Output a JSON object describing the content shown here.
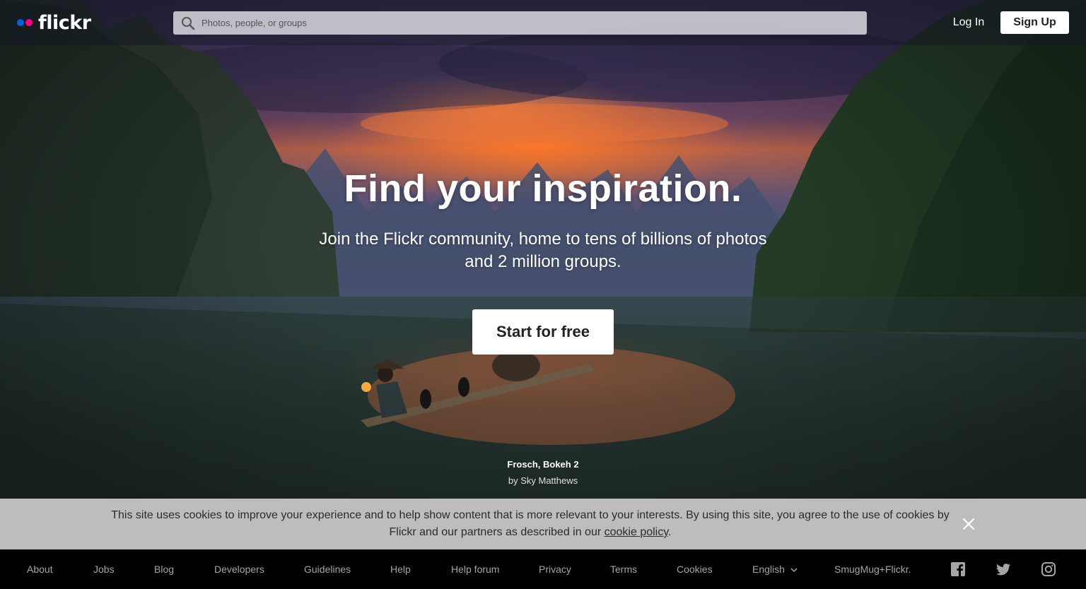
{
  "header": {
    "logo_text": "flickr",
    "search_placeholder": "Photos, people, or groups",
    "login_label": "Log In",
    "signup_label": "Sign Up"
  },
  "hero": {
    "headline": "Find your inspiration.",
    "subline": "Join the Flickr community, home to tens of billions of photos and 2 million groups.",
    "cta_label": "Start for free",
    "photo_credit": {
      "title": "Frosch, Bokeh 2",
      "author_prefix": "by",
      "author": "Sky Matthews"
    }
  },
  "cookie_banner": {
    "text_before_link": "This site uses cookies to improve your experience and to help show content that is more relevant to your interests. By using this site, you agree to the use of cookies by Flickr and our partners as described in our ",
    "link_label": "cookie policy",
    "text_after_link": ".",
    "close_icon": "close-icon"
  },
  "footer": {
    "links": [
      "About",
      "Jobs",
      "Blog",
      "Developers",
      "Guidelines",
      "Help",
      "Help forum",
      "Privacy",
      "Terms",
      "Cookies",
      "English",
      "SmugMug+Flickr."
    ],
    "social_icons": [
      "facebook-icon",
      "twitter-icon",
      "instagram-icon"
    ]
  },
  "colors": {
    "flickr_blue": "#0063dc",
    "flickr_pink": "#ff0084",
    "footer_bg": "#000000",
    "cookie_bg": "#bdbdbd"
  }
}
